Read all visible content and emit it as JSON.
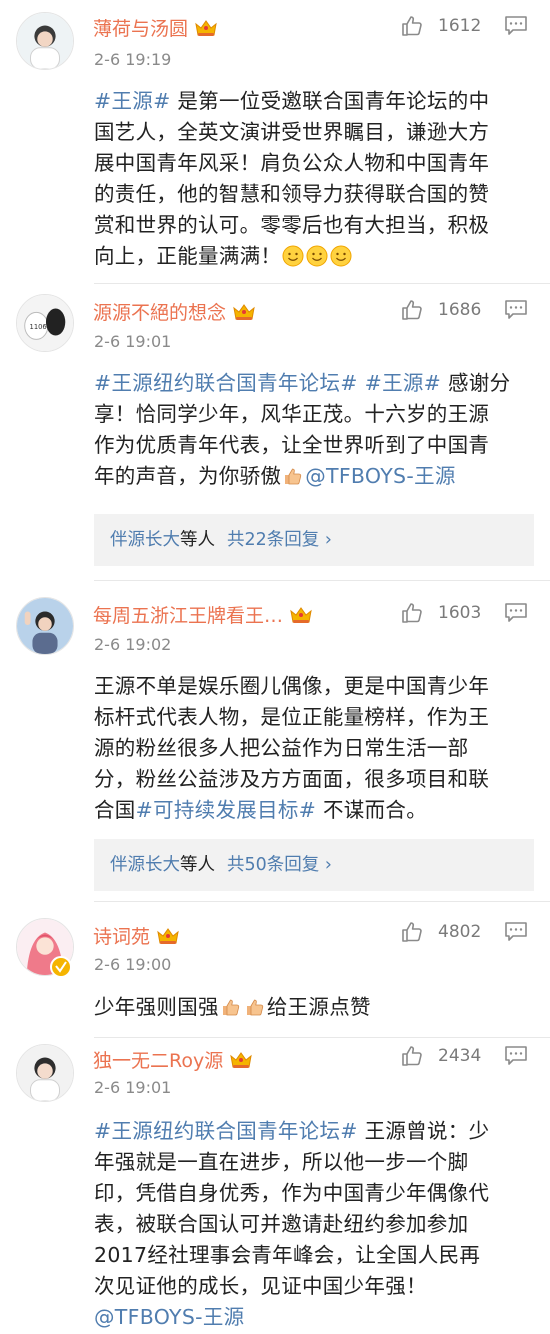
{
  "colors": {
    "username": "#eb7350",
    "link": "#507daf",
    "muted": "#8a8a8a",
    "reply_bg": "#f2f2f2"
  },
  "comments": [
    {
      "username": "薄荷与汤圆",
      "time": "2-6 19:19",
      "likes": "1612",
      "badge": "crown-icon",
      "lines": [
        [
          {
            "t": "#王源#",
            "tag": true
          },
          {
            "t": " 是第一位受邀联合国青年论坛的中"
          }
        ],
        [
          {
            "t": "国艺人，全英文演讲受世界瞩目，谦逊大方"
          }
        ],
        [
          {
            "t": "展中国青年风采！肩负公众人物和中国青年"
          }
        ],
        [
          {
            "t": "的责任，他的智慧和领导力获得联合国的赞"
          }
        ],
        [
          {
            "t": "赏和世界的认可。零零后也有大担当，积极"
          }
        ],
        [
          {
            "t": "向上，正能量满满！"
          }
        ]
      ]
    },
    {
      "username": "源源不絕的想念",
      "time": "2-6 19:01",
      "likes": "1686",
      "badge": "crown-icon",
      "lines": [
        [
          {
            "t": "#王源纽约联合国青年论坛#",
            "tag": true
          },
          {
            "t": " "
          },
          {
            "t": "#王源#",
            "tag": true
          },
          {
            "t": " 感谢分"
          }
        ],
        [
          {
            "t": "享！恰同学少年，风华正茂。十六岁的王源"
          }
        ],
        [
          {
            "t": "作为优质青年代表，让全世界听到了中国青"
          }
        ],
        [
          {
            "t": "年的声音，为你骄傲"
          },
          {
            "t": "@TFBOYS-王源",
            "tag": true
          }
        ]
      ],
      "replies": {
        "who": "伴源长大",
        "mid": "等人",
        "count": "共22条回复 ›"
      }
    },
    {
      "username": "每周五浙江王牌看王…",
      "time": "2-6 19:02",
      "likes": "1603",
      "badge": "crown-icon",
      "lines": [
        [
          {
            "t": "王源不单是娱乐圈儿偶像，更是中国青少年"
          }
        ],
        [
          {
            "t": "标杆式代表人物，是位正能量榜样，作为王"
          }
        ],
        [
          {
            "t": "源的粉丝很多人把公益作为日常生活一部"
          }
        ],
        [
          {
            "t": "分，粉丝公益涉及方方面面，很多项目和联"
          }
        ],
        [
          {
            "t": "合国"
          },
          {
            "t": "#可持续发展目标#",
            "tag": true
          },
          {
            "t": " 不谋而合。"
          }
        ]
      ],
      "replies": {
        "who": "伴源长大",
        "mid": "等人",
        "count": "共50条回复 ›"
      }
    },
    {
      "username": "诗词苑",
      "time": "2-6 19:00",
      "likes": "4802",
      "badge": "crown-icon",
      "lines": [
        [
          {
            "t": "少年强则国强"
          },
          {
            "t": "给王源点赞"
          }
        ]
      ]
    },
    {
      "username": "独一无二Roy源",
      "time": "2-6 19:01",
      "likes": "2434",
      "badge": "crown-icon",
      "lines": [
        [
          {
            "t": "#王源纽约联合国青年论坛#",
            "tag": true
          },
          {
            "t": " 王源曾说：少"
          }
        ],
        [
          {
            "t": "年强就是一直在进步，所以他一步一个脚"
          }
        ],
        [
          {
            "t": "印，凭借自身优秀，作为中国青少年偶像代"
          }
        ],
        [
          {
            "t": "表，被联合国认可并邀请赴纽约参加参加"
          }
        ],
        [
          {
            "t": "2017经社理事会青年峰会，让全国人民再"
          }
        ],
        [
          {
            "t": "次见证他的成长，见证中国少年强！"
          }
        ],
        [
          {
            "t": "@TFBOYS-王源",
            "tag": true
          }
        ]
      ]
    }
  ]
}
